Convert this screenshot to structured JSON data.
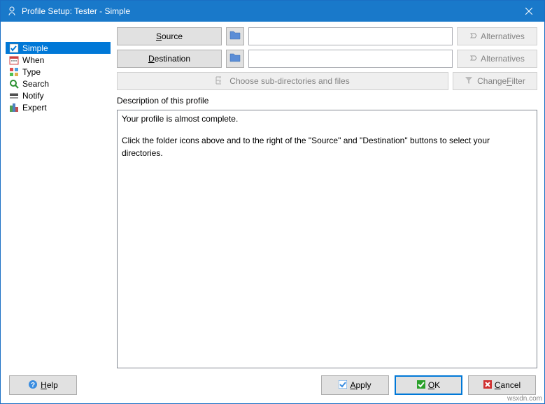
{
  "titlebar": {
    "title": "Profile Setup: Tester - Simple"
  },
  "sidebar": {
    "items": [
      {
        "label": "Simple"
      },
      {
        "label": "When"
      },
      {
        "label": "Type"
      },
      {
        "label": "Search"
      },
      {
        "label": "Notify"
      },
      {
        "label": "Expert"
      }
    ]
  },
  "buttons": {
    "source": "Source",
    "destination": "Destination",
    "alternatives": "Alternatives",
    "choose_sub": "Choose sub-directories and files",
    "change_filter": "Change Filter"
  },
  "inputs": {
    "source_path": "",
    "destination_path": ""
  },
  "group": {
    "description_label": "Description of this profile"
  },
  "description": {
    "line1": "Your profile is almost complete.",
    "line2": "Click the folder icons above and to the right of the \"Source\" and \"Destination\" buttons to select your directories."
  },
  "footer": {
    "help": "Help",
    "apply": "Apply",
    "ok": "OK",
    "cancel": "Cancel"
  },
  "watermark": "wsxdn.com"
}
